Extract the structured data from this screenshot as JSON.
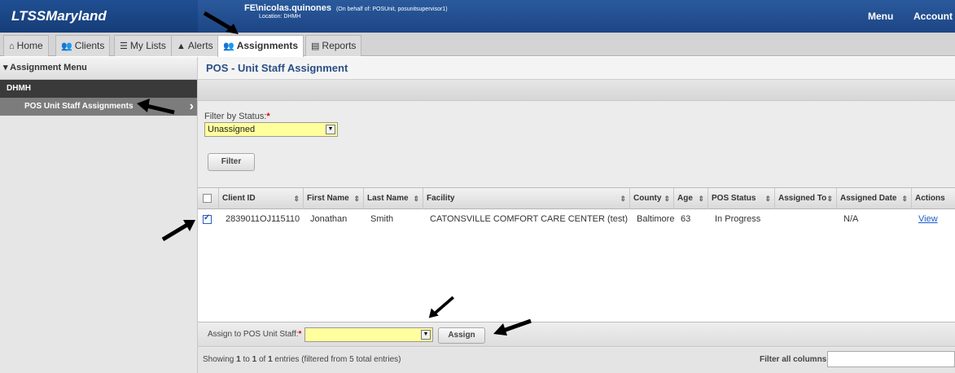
{
  "brand": "LTSSMaryland",
  "user": {
    "name": "FE\\nicolas.quinones",
    "on_behalf": "(On behalf of: POSUnit, posunitsupervisor1)",
    "location": "Location: DHMH"
  },
  "topnav": {
    "menu": "Menu",
    "account": "Account"
  },
  "tabs": [
    {
      "label": "Home",
      "icon": "house"
    },
    {
      "label": "Clients",
      "icon": "people"
    },
    {
      "label": "My Lists",
      "icon": "list"
    },
    {
      "label": "Alerts",
      "icon": "warning"
    },
    {
      "label": "Assignments",
      "icon": "people",
      "active": true
    },
    {
      "label": "Reports",
      "icon": "report"
    }
  ],
  "sidebar": {
    "header": "▾ Assignment Menu",
    "group": "DHMH",
    "item": "POS Unit Staff Assignments"
  },
  "main": {
    "title": "POS - Unit Staff Assignment",
    "filter_label": "Filter by Status:",
    "filter_value": "Unassigned",
    "filter_button": "Filter"
  },
  "table": {
    "columns": [
      "Client ID",
      "First Name",
      "Last Name",
      "Facility",
      "County",
      "Age",
      "POS Status",
      "Assigned To",
      "Assigned Date",
      "Actions"
    ],
    "rows": [
      {
        "checked": true,
        "client_id": "2839011OJ115110",
        "first_name": "Jonathan",
        "last_name": "Smith",
        "facility": "CATONSVILLE COMFORT CARE CENTER (test)",
        "county": "Baltimore",
        "age": "63",
        "pos_status": "In Progress",
        "assigned_to": "",
        "assigned_date": "N/A",
        "action": "View"
      }
    ]
  },
  "assign": {
    "label": "Assign to POS Unit Staff:",
    "value": "",
    "button": "Assign"
  },
  "footer": {
    "info_prefix": "Showing ",
    "from": "1",
    "mid1": " to ",
    "to": "1",
    "mid2": " of ",
    "total": "1",
    "suffix": " entries (filtered from 5 total entries)",
    "filter_label": "Filter all columns:",
    "filter_value": ""
  },
  "colors": {
    "header_blue": "#1d4585",
    "select_yellow": "#ffff9d",
    "link": "#1a5dc8",
    "required": "#dd0000"
  }
}
